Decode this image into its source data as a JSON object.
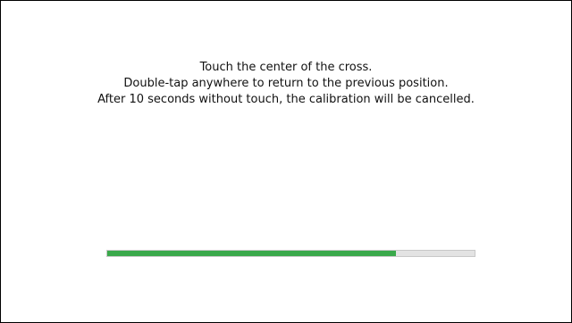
{
  "instructions": {
    "line1": "Touch the center of the cross.",
    "line2": "Double-tap anywhere to return to the previous position.",
    "line3": "After 10 seconds without touch, the calibration will be cancelled."
  },
  "progress": {
    "fraction": 0.785,
    "fill_color": "#3aa94b",
    "track_color": "#e3e3e3"
  }
}
